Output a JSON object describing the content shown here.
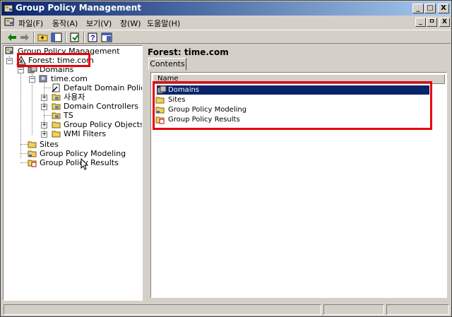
{
  "window": {
    "title": "Group Policy Management",
    "accent": "#0a246a",
    "caption_buttons": [
      "_",
      "□",
      "X"
    ]
  },
  "menu": {
    "items": [
      "파일(F)",
      "동작(A)",
      "보기(V)",
      "창(W)",
      "도움말(H)"
    ],
    "mdi_buttons": [
      "_",
      "ㅁ",
      "X"
    ]
  },
  "toolbar": {
    "buttons": [
      "back-arrow-icon",
      "forward-arrow-icon",
      "up-folder-icon",
      "show-hide-tree-icon",
      "export-list-icon",
      "help-icon",
      "properties-icon"
    ]
  },
  "tree": {
    "root": "Group Policy Management",
    "forest": "Forest: time.com",
    "domains": "Domains",
    "domain": "time.com",
    "domain_children": [
      "Default Domain Policy",
      "사용자",
      "Domain Controllers",
      "TS",
      "Group Policy Objects",
      "WMI Filters"
    ],
    "sites": "Sites",
    "modeling": "Group Policy Modeling",
    "results": "Group Policy Results"
  },
  "details": {
    "title": "Forest: time.com",
    "tab": "Contents",
    "column": "Name",
    "rows": [
      "Domains",
      "Sites",
      "Group Policy Modeling",
      "Group Policy Results"
    ],
    "selected_row": "Domains"
  },
  "highlight_color": "#e8000b"
}
